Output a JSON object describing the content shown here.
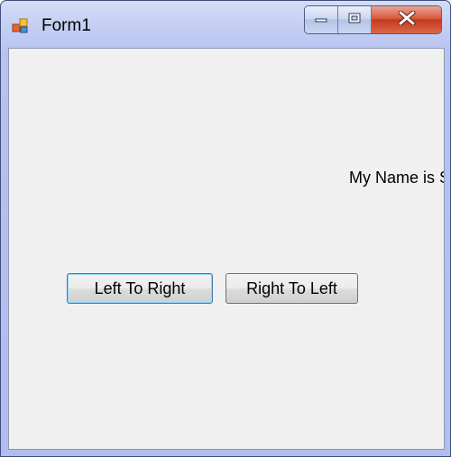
{
  "window": {
    "title": "Form1",
    "icon": "winforms-app-icon",
    "caption_buttons": [
      "minimize-icon",
      "restore-icon",
      "close-icon"
    ]
  },
  "form": {
    "label_text": "My Name is S",
    "buttons": {
      "left_to_right": "Left To Right",
      "right_to_left": "Right To Left"
    }
  },
  "colors": {
    "client_background": "#f0f0f0",
    "close_button": "#c4391c",
    "focused_button_border": "#3c7fb1"
  }
}
